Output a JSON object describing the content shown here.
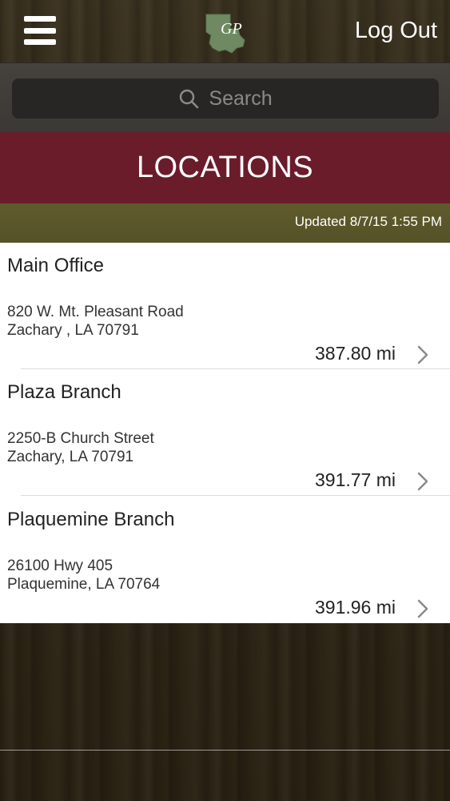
{
  "header": {
    "logout_label": "Log Out",
    "logo_text": "GP"
  },
  "search": {
    "placeholder": "Search"
  },
  "page": {
    "title": "LOCATIONS",
    "updated": "Updated 8/7/15 1:55 PM"
  },
  "locations": [
    {
      "name": "Main Office",
      "address1": "820 W. Mt. Pleasant Road",
      "address2": "Zachary , LA 70791",
      "distance": "387.80 mi"
    },
    {
      "name": "Plaza Branch",
      "address1": "2250-B Church Street",
      "address2": "Zachary, LA 70791",
      "distance": "391.77 mi"
    },
    {
      "name": "Plaquemine Branch",
      "address1": "26100 Hwy 405",
      "address2": "Plaquemine, LA 70764",
      "distance": "391.96 mi"
    }
  ],
  "icons": {
    "menu": "hamburger-menu-icon",
    "logo": "louisiana-state-logo-icon",
    "search": "search-icon",
    "chevron": "chevron-right-icon"
  },
  "colors": {
    "title_bar": "#6a1c2b",
    "updated_bar": "#5f5b2c",
    "logo_green": "#6f8a62"
  }
}
